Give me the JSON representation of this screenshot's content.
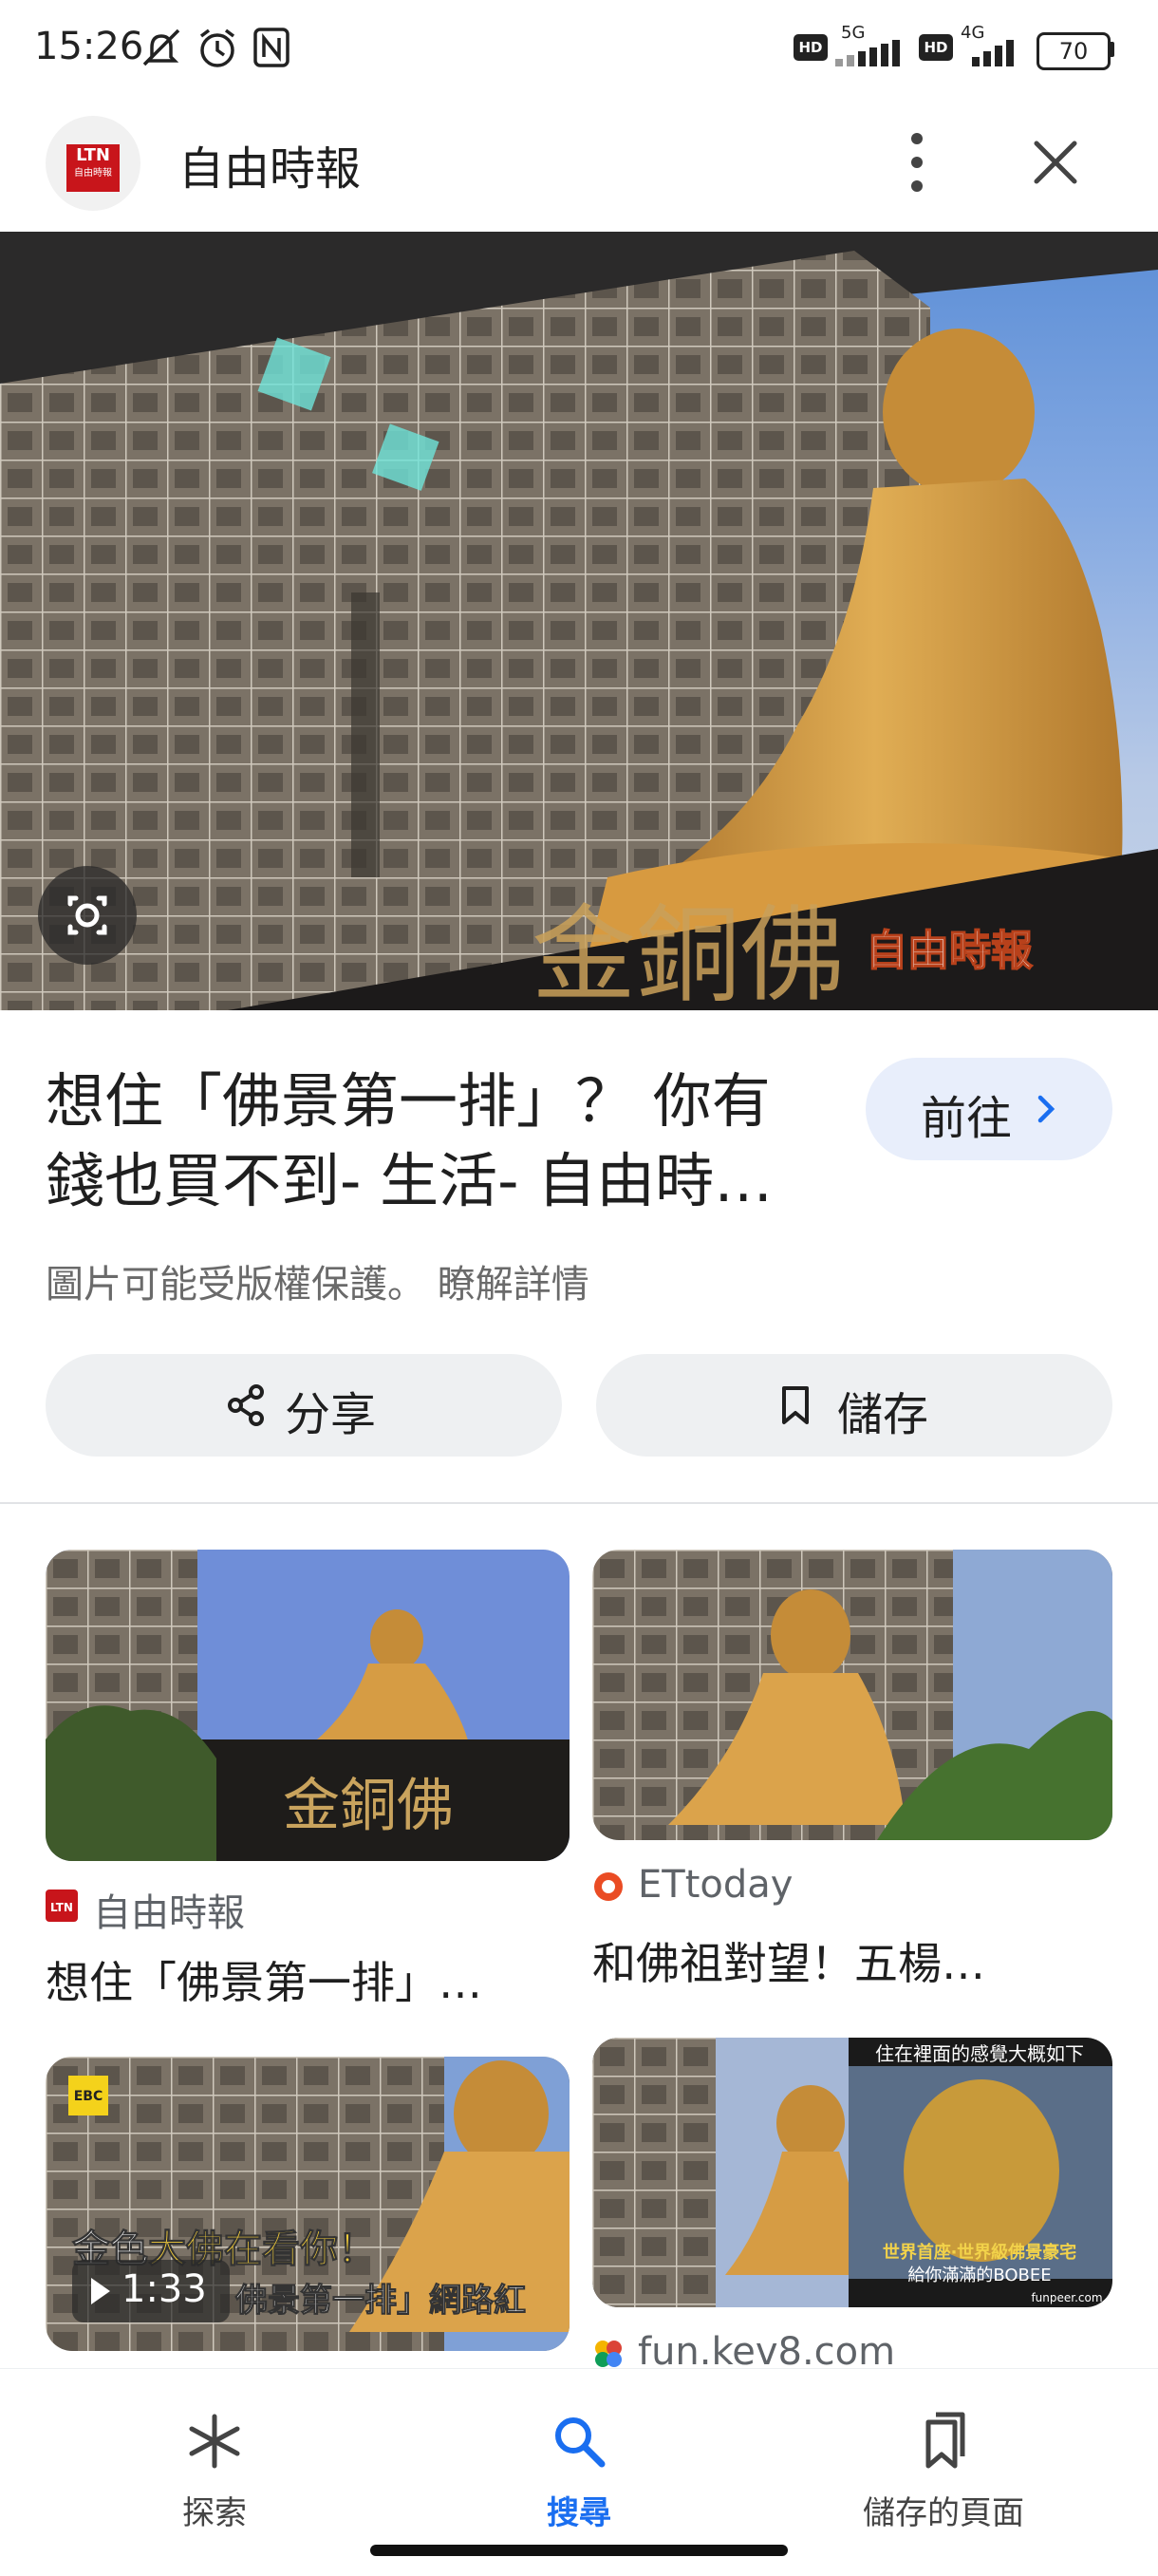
{
  "status_bar": {
    "time": "15:26",
    "net1": "5G",
    "net2": "4G",
    "hd": "HD",
    "battery": "70"
  },
  "header": {
    "site_name": "自由時報",
    "logo_text": "LTN",
    "logo_sub": "自由時報"
  },
  "hero": {
    "watermark": "自由時報",
    "sign_text": "金銅佛"
  },
  "result": {
    "title": "想住「佛景第一排」？ 你有錢也買不到- 生活- 自由時報電子報",
    "goto_label": "前往",
    "copyright_text": "圖片可能受版權保護。",
    "learn_more": "瞭解詳情",
    "share_label": "分享",
    "save_label": "儲存"
  },
  "grid": [
    {
      "source": "自由時報",
      "title": "想住「佛景第一排」…",
      "source_icon_text": "LTN"
    },
    {
      "source": "ETtoday",
      "title": "和佛祖對望！五楊…"
    },
    {
      "overlay_line1a": "金色",
      "overlay_line1b": "大佛在看你！",
      "overlay_line2": "佛景第一排」網路紅",
      "duration": "1:33",
      "badge": "EBC"
    },
    {
      "source": "fun.kev8.com",
      "overlay_top": "住在裡面的感覺大概如下",
      "overlay_mid": "世界首座‧世界級佛景豪宅",
      "overlay_bot": "給你滿滿的BOBEE",
      "credit": "funpeer.com"
    }
  ],
  "bottom_nav": {
    "items": [
      {
        "label": "探索",
        "icon": "asterisk-icon"
      },
      {
        "label": "搜尋",
        "icon": "search-icon"
      },
      {
        "label": "儲存的頁面",
        "icon": "bookmarks-icon"
      }
    ]
  },
  "colors": {
    "accent": "#1a6ef0",
    "goto_bg": "#e8eefb",
    "pill_bg": "#eef0f2",
    "text": "#1f1f1f",
    "muted": "#6a6a6a",
    "ltn_red": "#c8151b",
    "gold": "#c98e2e"
  }
}
